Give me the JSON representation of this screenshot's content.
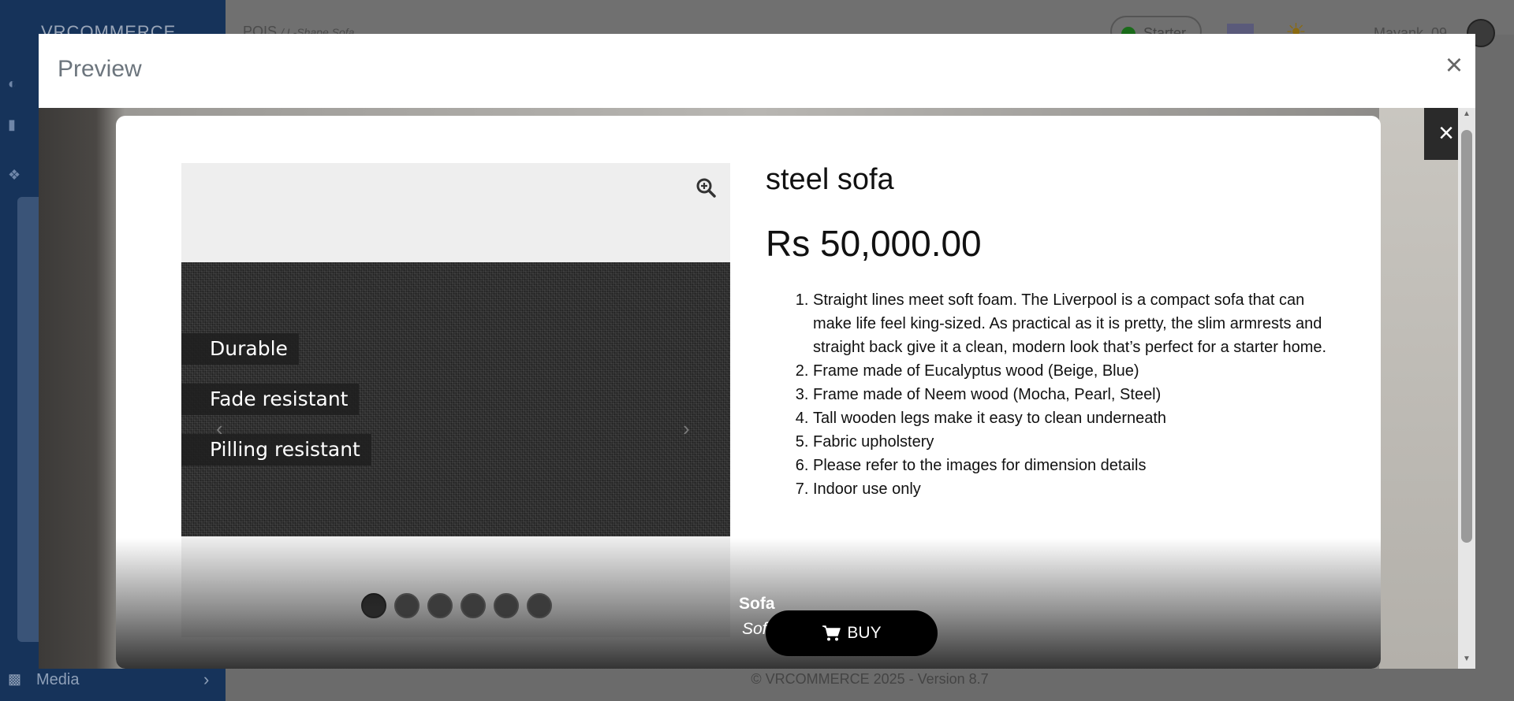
{
  "background_app": {
    "logo_text": "VRCOMMERCE",
    "breadcrumb": {
      "section": "POIS",
      "item": "/ L-Shape Sofa"
    },
    "plan_badge": "Starter",
    "user_name": "Mayank_09",
    "sidebar_bottom": {
      "label": "Media"
    },
    "footer": "© VRCOMMERCE 2025 - Version 8.7"
  },
  "preview_modal": {
    "title": "Preview",
    "close_label": "×"
  },
  "scene": {
    "close_label": "×"
  },
  "product": {
    "title": "steel sofa",
    "price": "Rs 50,000.00",
    "description": [
      "Straight lines meet soft foam. The Liverpool is a compact sofa that can make life feel king-sized. As practical as it is pretty, the slim armrests and straight back give it a clean, modern look that’s perfect for a starter home.",
      "Frame made of Eucalyptus wood (Beige, Blue)",
      "Frame made of Neem wood (Mocha, Pearl, Steel)",
      "Tall wooden legs make it easy to clean underneath",
      "Fabric upholstery",
      "Please refer to the images for dimension details",
      "Indoor use only"
    ],
    "image_tags": [
      "Durable",
      "Fade resistant",
      "Pilling resistant"
    ],
    "thumbnail_count": 6,
    "active_thumbnail": 1,
    "buy_label": "BUY",
    "category": "Sofa",
    "subcategory": "Soft"
  },
  "colors": {
    "sidebar_bg": "#16335a",
    "buy_button": "#000000",
    "modal_title": "#6c757d"
  },
  "icons": {
    "zoom": "zoom-in-icon",
    "cart": "cart-icon",
    "close": "close-icon",
    "prev": "chevron-left-icon",
    "next": "chevron-right-icon"
  }
}
